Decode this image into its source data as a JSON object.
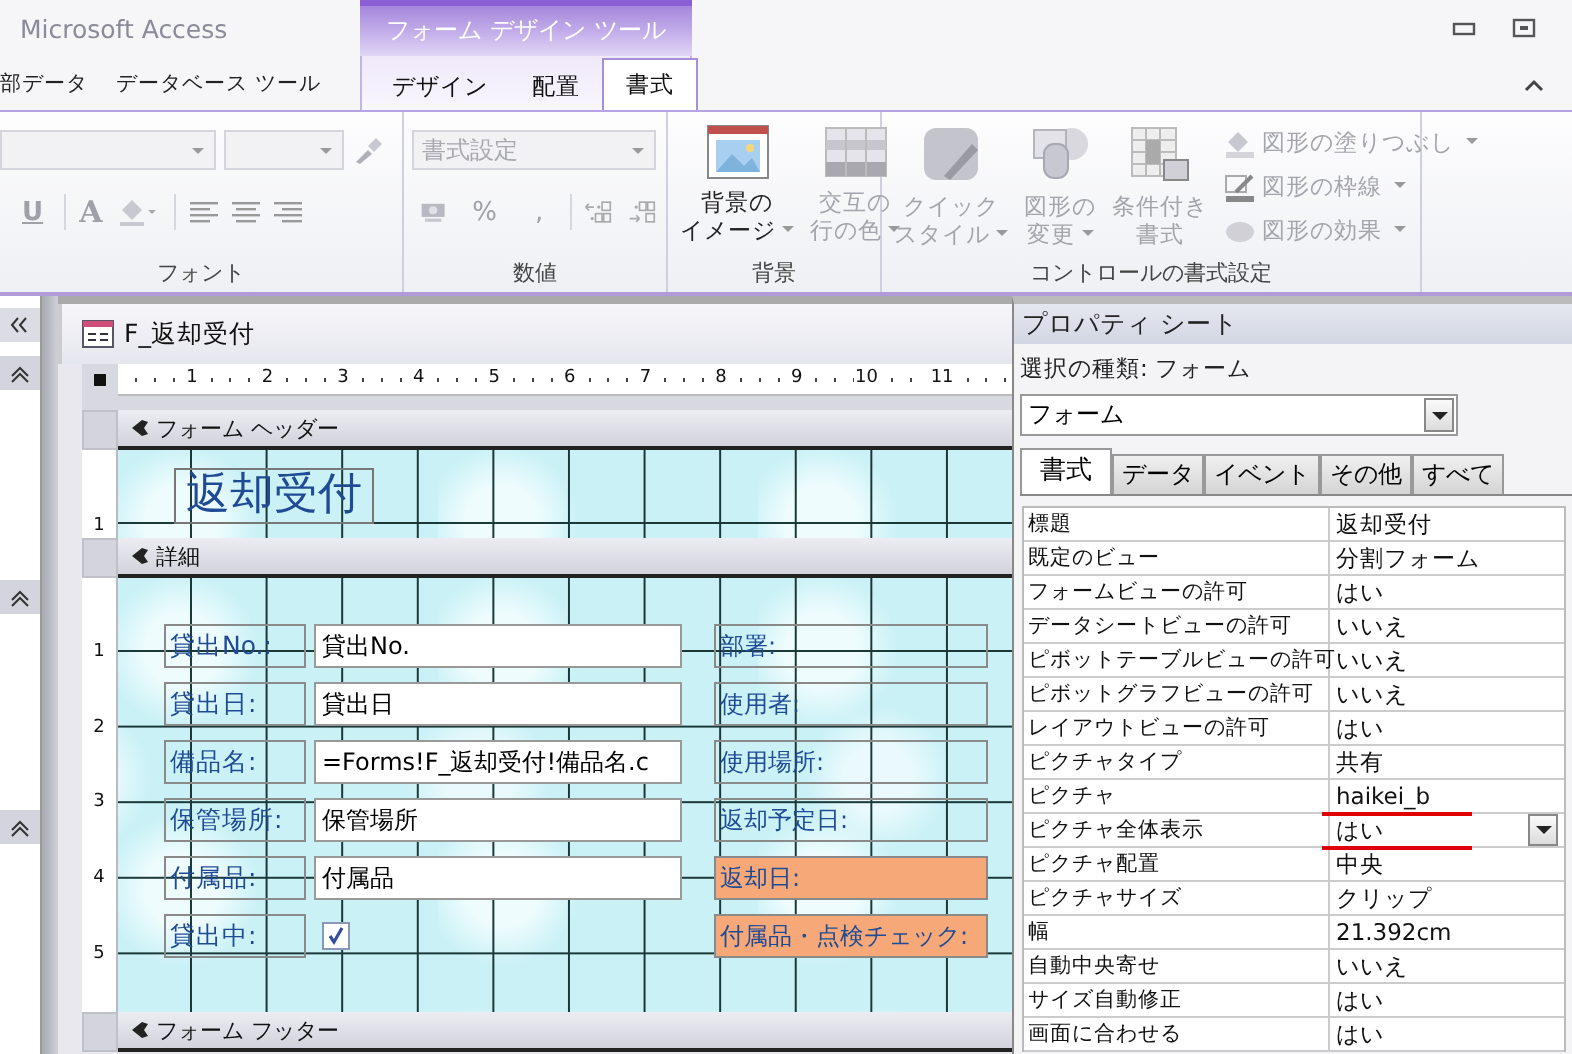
{
  "window": {
    "title": "Microsoft Access",
    "context_group": "フォーム デザイン ツール"
  },
  "ribbon_tabs": [
    {
      "label": "部データ",
      "selected": false,
      "contextual": false
    },
    {
      "label": "データベース ツール",
      "selected": false,
      "contextual": false
    },
    {
      "label": "デザイン",
      "selected": false,
      "contextual": true
    },
    {
      "label": "配置",
      "selected": false,
      "contextual": true
    },
    {
      "label": "書式",
      "selected": true,
      "contextual": true
    }
  ],
  "ribbon": {
    "font": {
      "label": "フォント",
      "disabled": true,
      "underline": "U",
      "font_color": "A"
    },
    "number": {
      "label": "数値",
      "disabled": true,
      "format": "書式設定",
      "percent": "%",
      "comma": ","
    },
    "background": {
      "label": "背景",
      "buttons": [
        {
          "lines": [
            "背景の",
            "イメージ"
          ],
          "disabled": false
        },
        {
          "lines": [
            "交互の",
            "行の色"
          ],
          "disabled": true
        }
      ]
    },
    "controls": {
      "label": "コントロールの書式設定",
      "buttons": [
        {
          "lines": [
            "クイック",
            "スタイル"
          ],
          "disabled": true
        },
        {
          "lines": [
            "図形の",
            "変更"
          ],
          "disabled": true
        },
        {
          "lines": [
            "条件付き",
            "書式"
          ],
          "disabled": true
        }
      ],
      "shape_buttons": [
        {
          "label": "図形の塗りつぶし",
          "disabled": true
        },
        {
          "label": "図形の枠線",
          "disabled": true
        },
        {
          "label": "図形の効果",
          "disabled": true
        }
      ]
    }
  },
  "form": {
    "title": "F_返却受付",
    "ruler": [
      "1",
      "2",
      "3",
      "4",
      "5",
      "6",
      "7",
      "8",
      "9",
      "10",
      "11"
    ],
    "header": {
      "label": "フォーム ヘッダー",
      "ruler": [
        "1"
      ],
      "title": "返却受付"
    },
    "detail": {
      "label": "詳細",
      "ruler": [
        "1",
        "2",
        "3",
        "4",
        "5"
      ],
      "rows": [
        {
          "label": "貸出No.:",
          "field": {
            "kind": "textbox",
            "value": "貸出No."
          },
          "right": {
            "text": "部署:",
            "highlighted": false
          }
        },
        {
          "label": "貸出日:",
          "field": {
            "kind": "textbox",
            "value": "貸出日"
          },
          "right": {
            "text": "使用者:",
            "highlighted": false
          }
        },
        {
          "label": "備品名:",
          "field": {
            "kind": "textbox",
            "value": "=Forms!F_返却受付!備品名.c"
          },
          "right": {
            "text": "使用場所:",
            "highlighted": false
          }
        },
        {
          "label": "保管場所:",
          "field": {
            "kind": "textbox",
            "value": "保管場所"
          },
          "right": {
            "text": "返却予定日:",
            "highlighted": false
          }
        },
        {
          "label": "付属品:",
          "field": {
            "kind": "textbox",
            "value": "付属品"
          },
          "right": {
            "text": "返却日:",
            "highlighted": true
          }
        },
        {
          "label": "貸出中:",
          "field": {
            "kind": "checkbox",
            "checked": true
          },
          "right": {
            "text": "付属品・点検チェック:",
            "highlighted": true
          }
        }
      ]
    },
    "footer": {
      "label": "フォーム フッター"
    }
  },
  "property_sheet": {
    "title": "プロパティ シート",
    "selection_type": "選択の種類: フォーム",
    "object": "フォーム",
    "tabs": [
      {
        "label": "書式",
        "selected": true
      },
      {
        "label": "データ",
        "selected": false
      },
      {
        "label": "イベント",
        "selected": false
      },
      {
        "label": "その他",
        "selected": false
      },
      {
        "label": "すべて",
        "selected": false
      }
    ],
    "rows": [
      {
        "name": "標題",
        "value": "返却受付",
        "selected": false,
        "underlined": false
      },
      {
        "name": "既定のビュー",
        "value": "分割フォーム",
        "selected": false,
        "underlined": false
      },
      {
        "name": "フォームビューの許可",
        "value": "はい",
        "selected": false,
        "underlined": false
      },
      {
        "name": "データシートビューの許可",
        "value": "いいえ",
        "selected": false,
        "underlined": false
      },
      {
        "name": "ピボットテーブルビューの許可",
        "value": "いいえ",
        "selected": false,
        "underlined": false
      },
      {
        "name": "ピボットグラフビューの許可",
        "value": "いいえ",
        "selected": false,
        "underlined": false
      },
      {
        "name": "レイアウトビューの許可",
        "value": "はい",
        "selected": false,
        "underlined": false
      },
      {
        "name": "ピクチャタイプ",
        "value": "共有",
        "selected": false,
        "underlined": false
      },
      {
        "name": "ピクチャ",
        "value": "haikei_b",
        "selected": false,
        "underlined": true
      },
      {
        "name": "ピクチャ全体表示",
        "value": "はい",
        "selected": true,
        "underlined": true
      },
      {
        "name": "ピクチャ配置",
        "value": "中央",
        "selected": false,
        "underlined": false
      },
      {
        "name": "ピクチャサイズ",
        "value": "クリップ",
        "selected": false,
        "underlined": false
      },
      {
        "name": "幅",
        "value": "21.392cm",
        "selected": false,
        "underlined": false
      },
      {
        "name": "自動中央寄せ",
        "value": "いいえ",
        "selected": false,
        "underlined": false
      },
      {
        "name": "サイズ自動修正",
        "value": "はい",
        "selected": false,
        "underlined": false
      },
      {
        "name": "画面に合わせる",
        "value": "はい",
        "selected": false,
        "underlined": false
      }
    ]
  }
}
